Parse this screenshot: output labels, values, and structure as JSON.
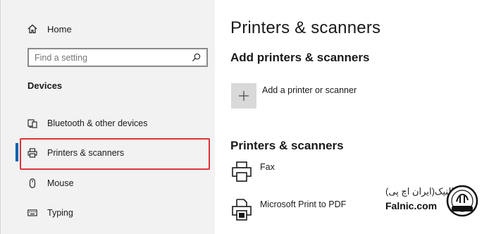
{
  "sidebar": {
    "home_label": "Home",
    "search": {
      "placeholder": "Find a setting",
      "value": ""
    },
    "section_heading": "Devices",
    "items": [
      {
        "label": "Bluetooth & other devices",
        "icon": "bluetooth-devices-icon",
        "active": false
      },
      {
        "label": "Printers & scanners",
        "icon": "printer-icon",
        "active": true
      },
      {
        "label": "Mouse",
        "icon": "mouse-icon",
        "active": false
      },
      {
        "label": "Typing",
        "icon": "keyboard-icon",
        "active": false
      }
    ]
  },
  "main": {
    "title": "Printers & scanners",
    "add_section": {
      "heading": "Add printers & scanners",
      "add_label": "Add a printer or scanner"
    },
    "printers_section": {
      "heading": "Printers & scanners",
      "printers": [
        {
          "name": "Fax",
          "icon": "fax-printer-icon"
        },
        {
          "name": "Microsoft Print to PDF",
          "icon": "pdf-printer-icon"
        }
      ]
    }
  },
  "watermark": {
    "fa_text": "فالنیک(ایران اچ پی)",
    "en_text": "Falnic.com",
    "logo_text": "iranhp.ir"
  },
  "colors": {
    "sidebar_bg": "#f2f2f2",
    "accent": "#0063b1",
    "highlight": "#e0333b",
    "add_tile_bg": "#d9d9d9"
  }
}
